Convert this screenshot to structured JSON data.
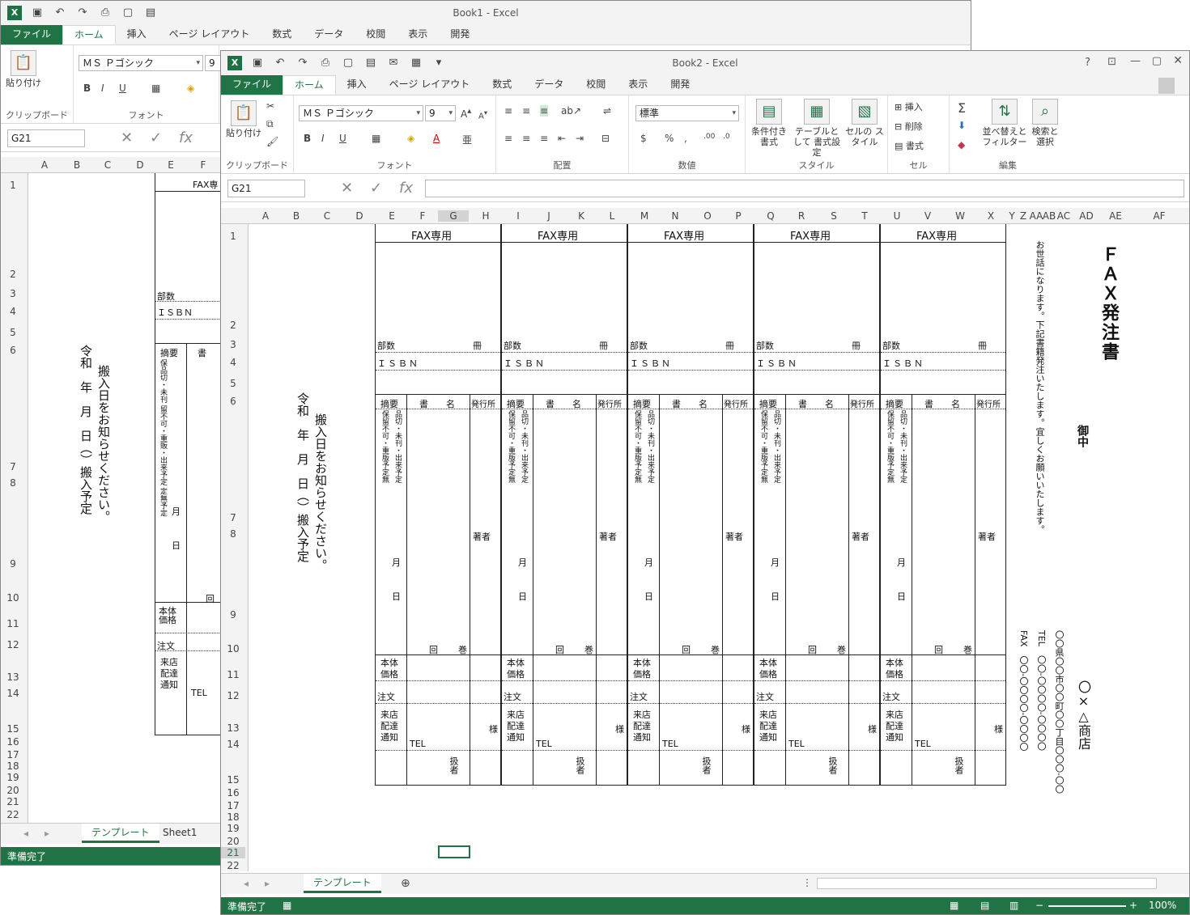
{
  "back_window": {
    "title": "Book1 - Excel",
    "menu": [
      "ファイル",
      "ホーム",
      "挿入",
      "ページ レイアウト",
      "数式",
      "データ",
      "校閲",
      "表示",
      "開発"
    ],
    "clipboard_label": "貼り付け",
    "group_clipboard": "クリップボード",
    "group_font": "フォント",
    "font_name": "ＭＳ Ｐゴシック",
    "font_size": "9",
    "name_box": "G21",
    "columns": [
      "A",
      "B",
      "C",
      "D",
      "E",
      "F"
    ],
    "rows": [
      "1",
      "2",
      "3",
      "4",
      "5",
      "6",
      "7",
      "8",
      "9",
      "10",
      "11",
      "12",
      "13",
      "14",
      "15",
      "16",
      "17",
      "18",
      "19",
      "20",
      "21",
      "22"
    ],
    "cells": {
      "fax_header": "FAX専",
      "busu": "部数",
      "isbn": "ＩＳＢＮ",
      "tekiyo": "摘要",
      "sho": "書",
      "status_text": "保品切・未刊 留不可・重販・出来予定 定無予定",
      "tsuki": "月",
      "hi": "日",
      "kai": "回",
      "hontai": "本体 価格",
      "chumon": "注文",
      "raiten": "来店 配達 通知",
      "tel": "TEL",
      "notice_1": "搬入日をお知らせください。",
      "notice_2": "令和　年　月　日（）搬入予定"
    },
    "sheet_tabs": [
      "テンプレート",
      "Sheet1"
    ],
    "status": "準備完了"
  },
  "front_window": {
    "title": "Book2 - Excel",
    "help": "?",
    "menu": [
      "ファイル",
      "ホーム",
      "挿入",
      "ページ レイアウト",
      "数式",
      "データ",
      "校閲",
      "表示",
      "開発"
    ],
    "ribbon": {
      "paste": "貼り付け",
      "group_clipboard": "クリップボード",
      "font_name": "ＭＳ Ｐゴシック",
      "font_size": "9",
      "group_font": "フォント",
      "group_align": "配置",
      "number_format": "標準",
      "group_number": "数値",
      "cond_format": "条件付き 書式",
      "table_format": "テーブルとして 書式設定",
      "cell_style": "セルの スタイル",
      "group_style": "スタイル",
      "insert": "挿入",
      "delete": "削除",
      "format": "書式",
      "group_cells": "セル",
      "sort_filter": "並べ替えと フィルター",
      "find_select": "検索と 選択",
      "group_edit": "編集"
    },
    "name_box": "G21",
    "columns": [
      "A",
      "B",
      "C",
      "D",
      "E",
      "F",
      "G",
      "H",
      "I",
      "J",
      "K",
      "L",
      "M",
      "N",
      "O",
      "P",
      "Q",
      "R",
      "S",
      "T",
      "U",
      "V",
      "W",
      "X",
      "Y",
      "Z",
      "AA",
      "AB",
      "AC",
      "AD",
      "AE",
      "AF"
    ],
    "rows": [
      "1",
      "2",
      "3",
      "4",
      "5",
      "6",
      "7",
      "8",
      "9",
      "10",
      "11",
      "12",
      "13",
      "14",
      "15",
      "16",
      "17",
      "18",
      "19",
      "20",
      "21",
      "22"
    ],
    "slip": {
      "fax": "FAX専用",
      "busu": "部数",
      "satsu": "冊",
      "isbn": "ＩＳＢＮ",
      "tekiyo": "摘要",
      "shomei": "書　　名",
      "hakko": "発行所",
      "status_col1": "保留不可・重版予定無",
      "status_col2": "品切・未刊・出来予定",
      "tsuki": "月",
      "hi": "日",
      "chosha": "著者",
      "kai": "回",
      "kan": "巻",
      "hontai": "本体",
      "kakaku": "価格",
      "chumon": "注文",
      "raiten1": "来店",
      "raiten2": "配達",
      "raiten3": "通知",
      "sama": "様",
      "tel": "TEL",
      "atsukai": "扱者"
    },
    "notice_1": "搬入日をお知らせください。",
    "notice_2": "令和　年　月　日（）搬入予定",
    "right_panel": {
      "title": "ＦＡＸ発注書",
      "greeting": "お世話になります。下記書籍発注いたします。宜しくお願いいたします。",
      "onchu": "御中",
      "shop": "〇×△商店",
      "address": "〇〇県〇〇市〇〇町〇〇丁目〇〇〇-〇〇",
      "tel": "TEL　〇〇-〇〇〇〇-〇〇〇〇",
      "fax": "FAX　〇〇-〇〇〇〇-〇〇〇〇"
    },
    "sheet_tab": "テンプレート",
    "status": "準備完了",
    "zoom": "100%"
  }
}
